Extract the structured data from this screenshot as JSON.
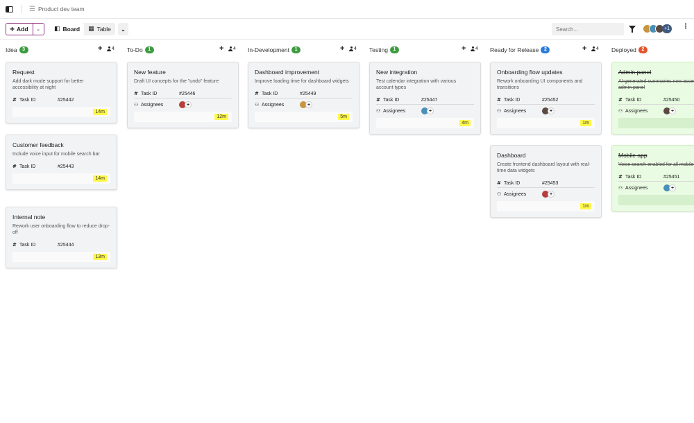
{
  "topbar": {
    "team_name": "Product dev team"
  },
  "toolbar": {
    "add_label": "Add",
    "board_label": "Board",
    "table_label": "Table",
    "search_placeholder": "Search...",
    "extra_members": "+1"
  },
  "colors": {
    "accent": "#8e2c7c",
    "green": "#3d9b3f",
    "blue": "#2b7bd9",
    "red": "#e5532d",
    "time_chip": "#fff84a"
  },
  "columns": [
    {
      "title": "Idea",
      "count": "3",
      "users": "4",
      "badge_color": "#3d9b3f",
      "cards": [
        {
          "title": "Request",
          "desc": "Add dark mode support for better accessibility at night",
          "task_id": "#25442",
          "time": "14m"
        },
        {
          "title": "Customer feedback",
          "desc": "Include voice input for mobile search bar",
          "task_id": "#25443",
          "time": "14m"
        },
        {
          "title": "Internal note",
          "desc": "Rework user onboarding flow to reduce drop-off",
          "task_id": "#25444",
          "time": "13m"
        }
      ]
    },
    {
      "title": "To-Do",
      "count": "1",
      "users": "4",
      "badge_color": "#3d9b3f",
      "cards": [
        {
          "title": "New feature",
          "desc": "Draft UI concepts for the \"undo\" feature",
          "task_id": "#25446",
          "time": "12m"
        }
      ]
    },
    {
      "title": "In-Development",
      "count": "1",
      "users": "4",
      "badge_color": "#3d9b3f",
      "cards": [
        {
          "title": "Dashboard improvement",
          "desc": "Improve loading time for dashboard widgets",
          "task_id": "#25449",
          "time": "5m"
        }
      ]
    },
    {
      "title": "Testing",
      "count": "1",
      "users": "4",
      "badge_color": "#3d9b3f",
      "cards": [
        {
          "title": "New integration",
          "desc": "Test calendar integration with various account types",
          "task_id": "#25447",
          "time": "4m"
        }
      ]
    },
    {
      "title": "Ready for Release",
      "count": "2",
      "users": "4",
      "badge_color": "#2b7bd9",
      "cards": [
        {
          "title": "Onboarding flow updates",
          "desc": "Rework onboarding UI components and transitions",
          "task_id": "#25452",
          "time": "1m"
        },
        {
          "title": "Dashboard",
          "desc": "Create frontend dashboard layout with real-time data widgets",
          "task_id": "#25453",
          "time": "1m"
        }
      ]
    },
    {
      "title": "Deployed",
      "count": "2",
      "badge_color": "#e5532d",
      "cards": [
        {
          "title": "Admin panel",
          "desc": "AI-generated summaries now accessible in admin panel",
          "task_id": "#25450"
        },
        {
          "title": "Mobile app",
          "desc": "Voice search enabled for all mobile users",
          "task_id": "#25451"
        }
      ]
    }
  ],
  "labels": {
    "task_id": "Task ID",
    "assignees": "Assignees"
  },
  "icons": {
    "sidebar": "sidebar-toggle-icon",
    "list": "list-icon",
    "board": "board-icon",
    "table": "table-icon",
    "filter": "filter-icon",
    "more": "more-vertical-icon",
    "add": "plus-icon",
    "users": "users-icon",
    "hash": "hash-icon",
    "people": "people-icon"
  }
}
